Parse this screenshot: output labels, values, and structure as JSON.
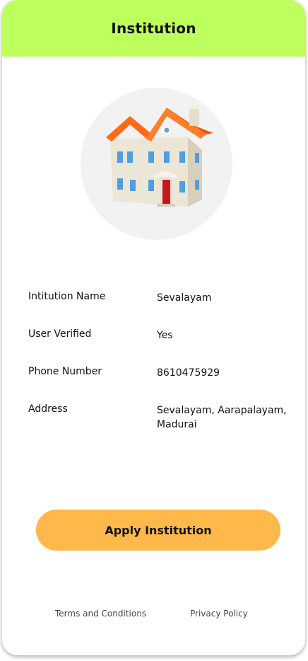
{
  "header": {
    "title": "Institution"
  },
  "details": {
    "rows": [
      {
        "label": "Intitution Name",
        "value": "Sevalayam"
      },
      {
        "label": "User Verified",
        "value": "Yes"
      },
      {
        "label": "Phone Number",
        "value": "8610475929"
      },
      {
        "label": "Address",
        "value": "Sevalayam, Aarapalayam, Madurai"
      }
    ]
  },
  "actions": {
    "apply_label": "Apply Institution"
  },
  "footer": {
    "terms_label": "Terms and Conditions",
    "privacy_label": "Privacy Policy"
  },
  "image": {
    "icon": "house-illustration"
  },
  "colors": {
    "header_bg": "#bdff5c",
    "button_bg": "#ffb84a",
    "avatar_bg": "#f2f2f2"
  }
}
